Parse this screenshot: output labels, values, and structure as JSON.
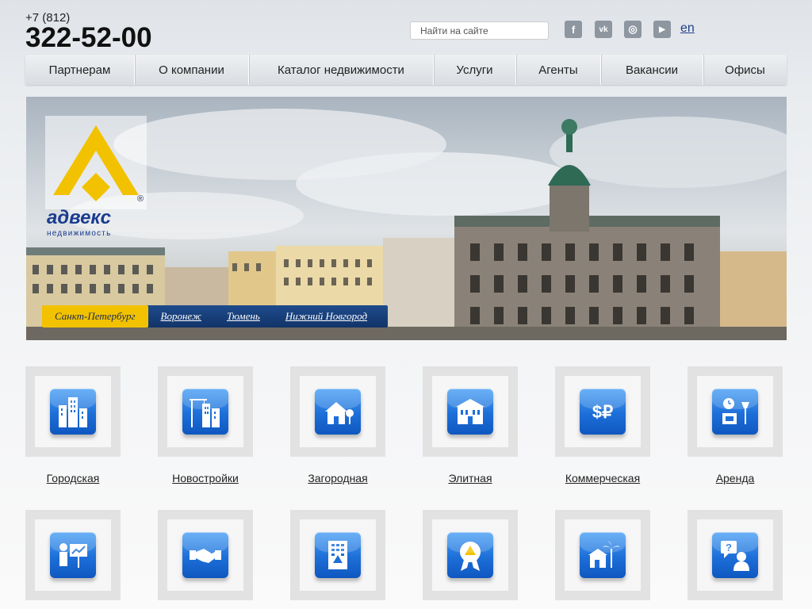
{
  "header": {
    "phone_code": "+7 (812)",
    "phone_number": "322-52-00",
    "search_placeholder": "Найти на сайте",
    "lang_link": "en",
    "social": [
      {
        "name": "facebook",
        "glyph": "f"
      },
      {
        "name": "vkontakte",
        "glyph": "vk"
      },
      {
        "name": "instagram",
        "glyph": "◎"
      },
      {
        "name": "youtube",
        "glyph": "▶"
      }
    ]
  },
  "nav": {
    "items": [
      {
        "label": "Партнерам"
      },
      {
        "label": "О компании"
      },
      {
        "label": "Каталог недвижимости"
      },
      {
        "label": "Услуги"
      },
      {
        "label": "Агенты"
      },
      {
        "label": "Вакансии"
      },
      {
        "label": "Офисы"
      }
    ]
  },
  "banner": {
    "logo_text": "адвекс",
    "logo_subtext": "недвижимость",
    "logo_mark": "®",
    "cities": [
      {
        "label": "Санкт-Петербург",
        "active": true
      },
      {
        "label": "Воронеж",
        "active": false
      },
      {
        "label": "Тюмень",
        "active": false
      },
      {
        "label": "Нижний Новгород",
        "active": false
      }
    ]
  },
  "categories": {
    "row1": [
      {
        "label": "Городская",
        "icon": "city-buildings-icon"
      },
      {
        "label": "Новостройки",
        "icon": "crane-building-icon"
      },
      {
        "label": "Загородная",
        "icon": "country-house-icon"
      },
      {
        "label": "Элитная",
        "icon": "mansion-icon"
      },
      {
        "label": "Коммерческая",
        "icon": "dollar-ruble-icon"
      },
      {
        "label": "Аренда",
        "icon": "clock-lamp-icon"
      }
    ],
    "row2": [
      {
        "icon": "presentation-icon"
      },
      {
        "icon": "handshake-icon"
      },
      {
        "icon": "office-building-icon"
      },
      {
        "icon": "award-badge-icon"
      },
      {
        "icon": "palm-resort-icon"
      },
      {
        "icon": "question-person-icon"
      }
    ]
  },
  "colors": {
    "accent_blue": "#1d6fd8",
    "logo_yellow": "#f2c200",
    "nav_dark_blue": "#123469"
  }
}
